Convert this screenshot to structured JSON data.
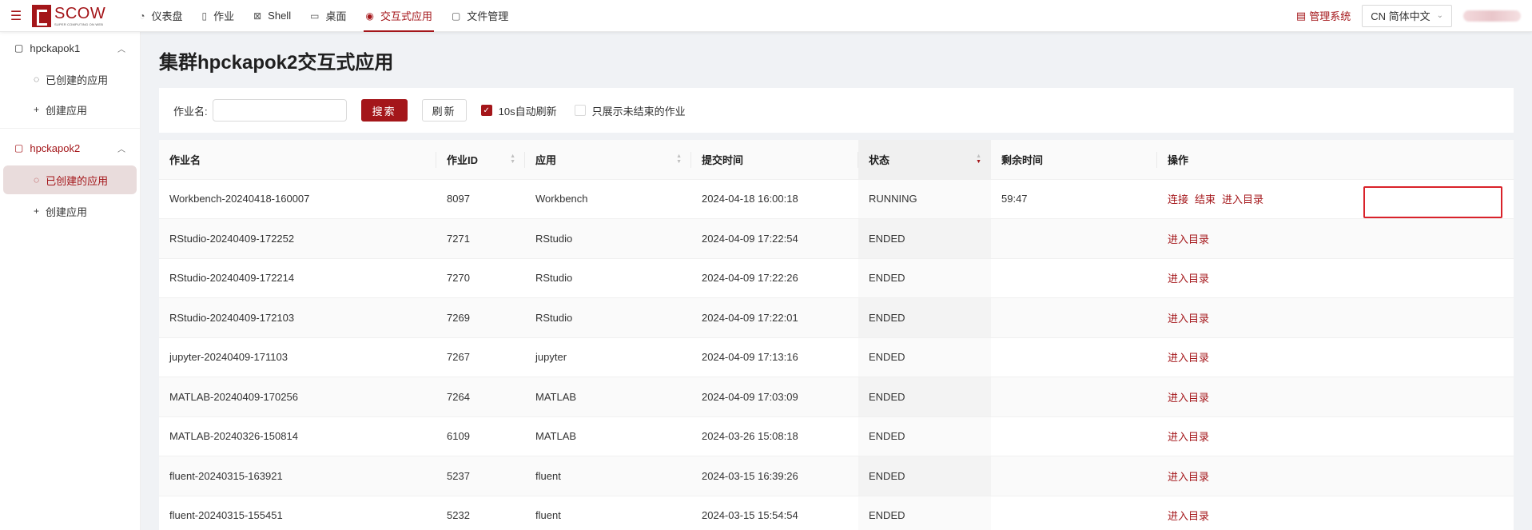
{
  "header": {
    "brand": "SCOW",
    "brand_sub": "SUPER COMPUTING ON WEB",
    "nav": [
      {
        "label": "仪表盘",
        "icon": "dashboard-icon",
        "glyph": "◔"
      },
      {
        "label": "作业",
        "icon": "file-icon",
        "glyph": "▯"
      },
      {
        "label": "Shell",
        "icon": "terminal-icon",
        "glyph": "⊠"
      },
      {
        "label": "桌面",
        "icon": "desktop-icon",
        "glyph": "▭"
      },
      {
        "label": "交互式应用",
        "icon": "eye-icon",
        "glyph": "◉",
        "active": true
      },
      {
        "label": "文件管理",
        "icon": "folder-icon",
        "glyph": "▢"
      }
    ],
    "admin_link": "管理系统",
    "language": "CN 简体中文"
  },
  "sidebar": {
    "groups": [
      {
        "label": "hpckapok1",
        "items": [
          {
            "label": "已创建的应用"
          },
          {
            "label": "创建应用"
          }
        ]
      },
      {
        "label": "hpckapok2",
        "active": true,
        "items": [
          {
            "label": "已创建的应用",
            "selected": true
          },
          {
            "label": "创建应用"
          }
        ]
      }
    ]
  },
  "page": {
    "title": "集群hpckapok2交互式应用"
  },
  "filter": {
    "job_name_label": "作业名:",
    "job_name_value": "",
    "search_label": "搜索",
    "refresh_label": "刷新",
    "auto_refresh_label": "10s自动刷新",
    "auto_refresh_checked": true,
    "only_unfinished_label": "只展示未结束的作业",
    "only_unfinished_checked": false
  },
  "table": {
    "columns": [
      "作业名",
      "作业ID",
      "应用",
      "提交时间",
      "状态",
      "剩余时间",
      "操作"
    ],
    "rows": [
      {
        "name": "Workbench-20240418-160007",
        "id": "8097",
        "app": "Workbench",
        "submit_time": "2024-04-18 16:00:18",
        "status": "RUNNING",
        "remaining": "59:47",
        "actions": [
          "连接",
          "结束",
          "进入目录"
        ]
      },
      {
        "name": "RStudio-20240409-172252",
        "id": "7271",
        "app": "RStudio",
        "submit_time": "2024-04-09 17:22:54",
        "status": "ENDED",
        "remaining": "",
        "actions": [
          "进入目录"
        ]
      },
      {
        "name": "RStudio-20240409-172214",
        "id": "7270",
        "app": "RStudio",
        "submit_time": "2024-04-09 17:22:26",
        "status": "ENDED",
        "remaining": "",
        "actions": [
          "进入目录"
        ]
      },
      {
        "name": "RStudio-20240409-172103",
        "id": "7269",
        "app": "RStudio",
        "submit_time": "2024-04-09 17:22:01",
        "status": "ENDED",
        "remaining": "",
        "actions": [
          "进入目录"
        ]
      },
      {
        "name": "jupyter-20240409-171103",
        "id": "7267",
        "app": "jupyter",
        "submit_time": "2024-04-09 17:13:16",
        "status": "ENDED",
        "remaining": "",
        "actions": [
          "进入目录"
        ]
      },
      {
        "name": "MATLAB-20240409-170256",
        "id": "7264",
        "app": "MATLAB",
        "submit_time": "2024-04-09 17:03:09",
        "status": "ENDED",
        "remaining": "",
        "actions": [
          "进入目录"
        ]
      },
      {
        "name": "MATLAB-20240326-150814",
        "id": "6109",
        "app": "MATLAB",
        "submit_time": "2024-03-26 15:08:18",
        "status": "ENDED",
        "remaining": "",
        "actions": [
          "进入目录"
        ]
      },
      {
        "name": "fluent-20240315-163921",
        "id": "5237",
        "app": "fluent",
        "submit_time": "2024-03-15 16:39:26",
        "status": "ENDED",
        "remaining": "",
        "actions": [
          "进入目录"
        ]
      },
      {
        "name": "fluent-20240315-155451",
        "id": "5232",
        "app": "fluent",
        "submit_time": "2024-03-15 15:54:54",
        "status": "ENDED",
        "remaining": "",
        "actions": [
          "进入目录"
        ]
      }
    ]
  },
  "colors": {
    "accent": "#a4161a",
    "highlight_box": "#d9222a"
  }
}
